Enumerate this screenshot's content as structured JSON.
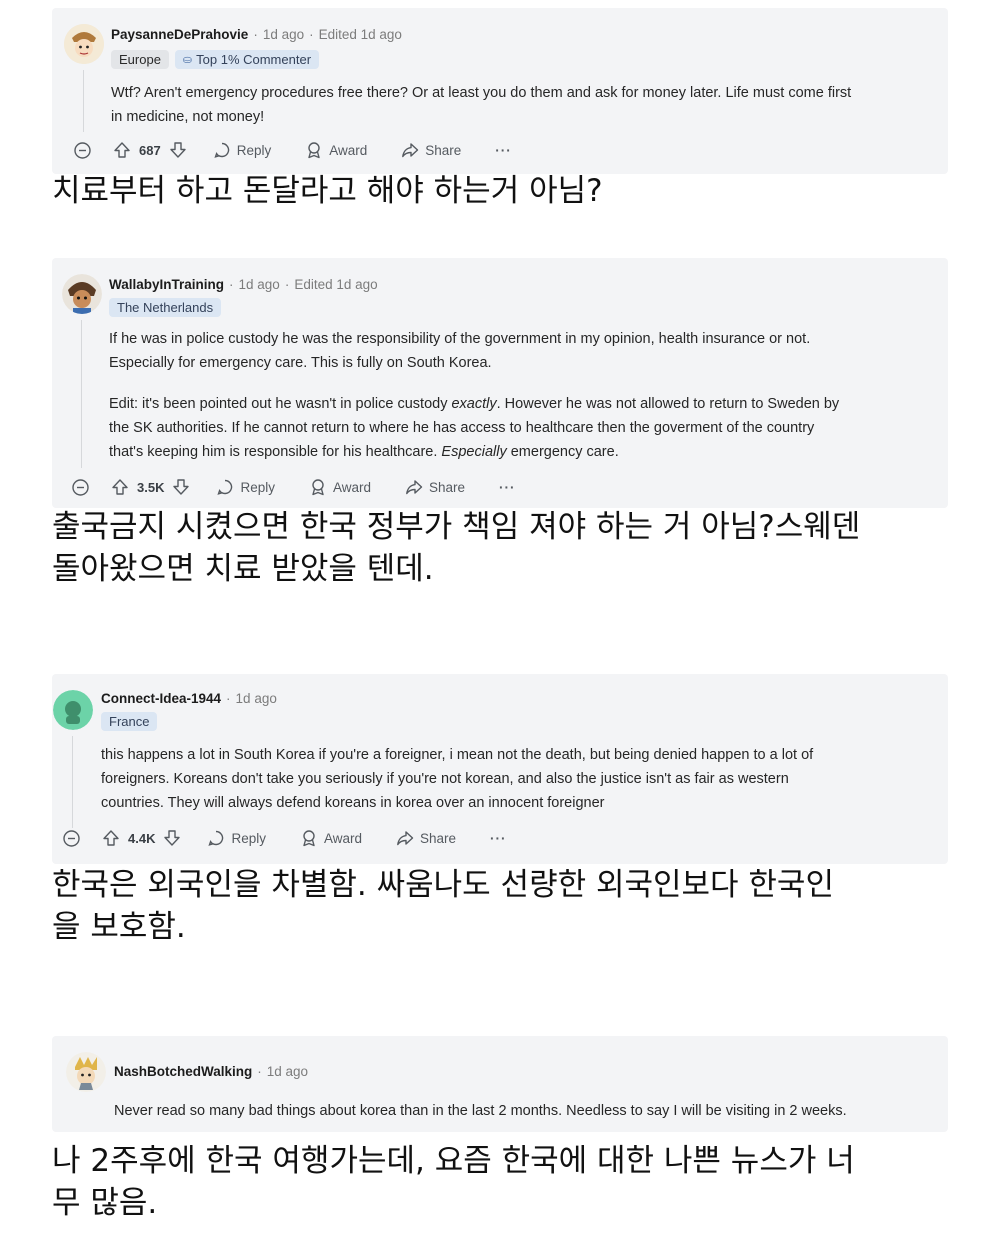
{
  "comments": [
    {
      "username": "PaysanneDePrahovie",
      "time": "1d ago",
      "edited": "Edited 1d ago",
      "flairs": [
        "Europe",
        "Top 1% Commenter"
      ],
      "paragraphs": [
        [
          "Wtf? Aren't emergency procedures free there? Or at least you do them and ask for money later. Life must come first",
          "in medicine, not money!"
        ]
      ],
      "votes": "687",
      "actions": {
        "reply": "Reply",
        "award": "Award",
        "share": "Share",
        "more": "···"
      },
      "translation": [
        "치료부터 하고 돈달라고 해야 하는거 아님?"
      ]
    },
    {
      "username": "WallabyInTraining",
      "time": "1d ago",
      "edited": "Edited 1d ago",
      "flairs": [
        "The Netherlands"
      ],
      "paragraphs": [
        [
          "If he was in police custody he was the responsibility of the government in my opinion, health insurance or not.",
          "Especially for emergency care. This is fully on South Korea."
        ],
        [
          "Edit: it's been pointed out he wasn't in police custody exactly. However he was not allowed to return to Sweden by",
          "the SK authorities. If he cannot return to where he has access to healthcare then the goverment of the country",
          "that's keeping him is responsible for his healthcare. Especially emergency care."
        ]
      ],
      "votes": "3.5K",
      "actions": {
        "reply": "Reply",
        "award": "Award",
        "share": "Share",
        "more": "···"
      },
      "translation": [
        "출국금지 시켰으면 한국 정부가 책임 져야 하는 거 아님?스웨덴",
        "돌아왔으면 치료 받았을 텐데."
      ]
    },
    {
      "username": "Connect-Idea-1944",
      "time": "1d ago",
      "flairs": [
        "France"
      ],
      "paragraphs": [
        [
          "this happens a lot in South Korea if you're a foreigner, i mean not the death, but being denied happen to a lot of",
          "foreigners. Koreans don't take you seriously if you're not korean, and also the justice isn't as fair as western",
          "countries. They will always defend koreans in korea over an innocent foreigner"
        ]
      ],
      "votes": "4.4K",
      "actions": {
        "reply": "Reply",
        "award": "Award",
        "share": "Share",
        "more": "···"
      },
      "translation": [
        "한국은 외국인을 차별함. 싸움나도 선량한 외국인보다 한국인",
        "을 보호함."
      ]
    },
    {
      "username": "NashBotchedWalking",
      "time": "1d ago",
      "paragraphs": [
        [
          "Never read so many bad things about korea than in the last 2 months. Needless to say I will be visiting in 2 weeks."
        ]
      ],
      "translation": [
        "나 2주후에 한국 여행가는데, 요즘 한국에 대한 나쁜 뉴스가 너",
        "무 많음."
      ]
    }
  ],
  "colors": {
    "card_bg": "#f3f4f6",
    "flair_bg": "#e3e5e8",
    "top_commenter_flair_bg": "#dbe6f3",
    "meta_text": "#7c7c7c",
    "action_text": "#555a60"
  },
  "icons": [
    "collapse-icon",
    "upvote-icon",
    "downvote-icon",
    "reply-icon",
    "award-icon",
    "share-icon",
    "more-icon",
    "top-commenter-icon"
  ]
}
